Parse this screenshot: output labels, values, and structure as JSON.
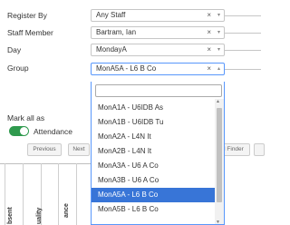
{
  "form": {
    "register_by": {
      "label": "Register By",
      "value": "Any Staff"
    },
    "staff_member": {
      "label": "Staff Member",
      "value": "Bartram, Ian"
    },
    "day": {
      "label": "Day",
      "value": "MondayA"
    },
    "group": {
      "label": "Group",
      "value": "MonA5A - L6 B Co"
    },
    "mark_all_as": {
      "label": "Mark all as"
    },
    "attendance_toggle": {
      "label": "Attendance",
      "on": true
    }
  },
  "icons": {
    "clear": "×",
    "arrow_down": "▾",
    "arrow_up": "▴",
    "scroll_up": "▲",
    "scroll_down": "▼"
  },
  "pager": {
    "previous": "Previous",
    "next": "Next",
    "finder_fragment": "l Finder"
  },
  "table": {
    "column_headers": [
      "bsent",
      "uality",
      "ance"
    ]
  },
  "dropdown": {
    "search_value": "",
    "options": [
      "MonA1A - U6IDB As",
      "MonA1B - U6IDB Tu",
      "MonA2A - L4N It",
      "MonA2B - L4N It",
      "MonA3A - U6 A Co",
      "MonA3B - U6 A Co",
      "MonA5A - L6 B Co",
      "MonA5B - L6 B Co"
    ],
    "selected_index": 6
  },
  "colors": {
    "highlight": "#3875d7",
    "toggle_on": "#2f9a4e",
    "focus_border": "#5897fb"
  }
}
